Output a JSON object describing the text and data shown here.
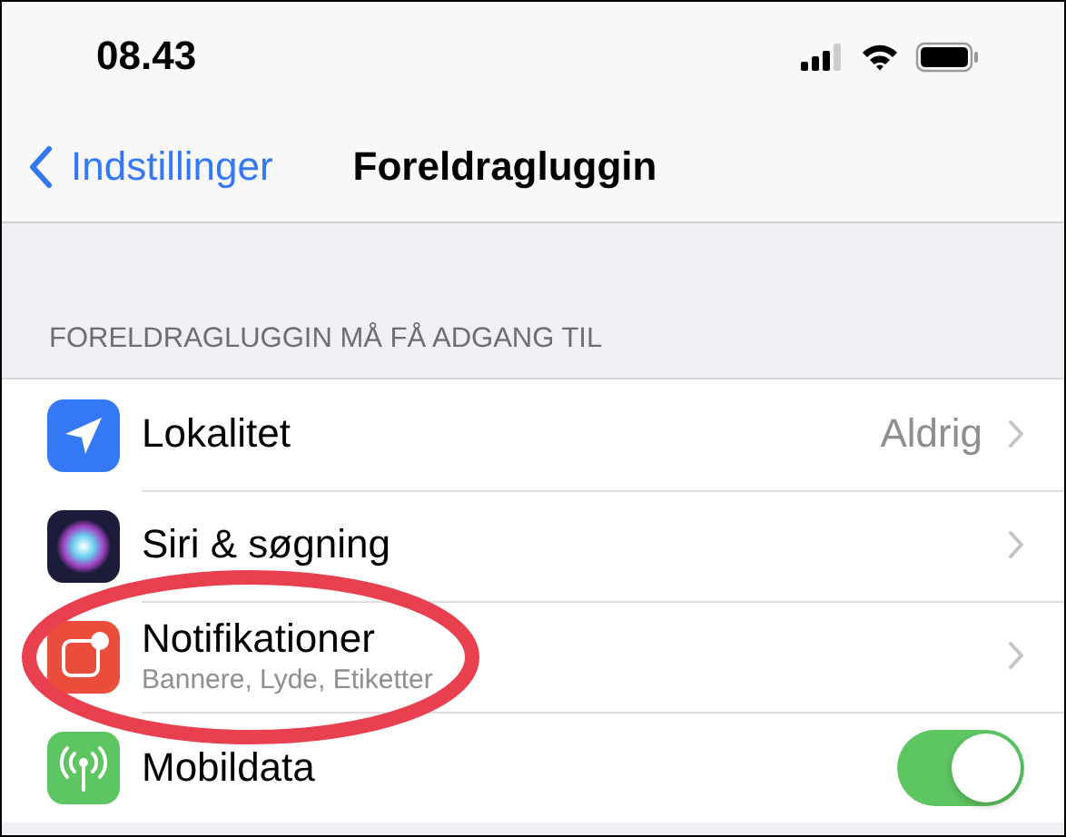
{
  "status_bar": {
    "time": "08.43"
  },
  "nav": {
    "back": "Indstillinger",
    "title": "Foreldragluggin"
  },
  "section": {
    "header": "FORELDRAGLUGGIN MÅ FÅ ADGANG TIL",
    "rows": [
      {
        "kind": "link",
        "label": "Lokalitet",
        "value": "Aldrig",
        "highlighted": false
      },
      {
        "kind": "link",
        "label": "Siri & søgning",
        "highlighted": false
      },
      {
        "kind": "link",
        "label": "Notifikationer",
        "subtitle": "Bannere, Lyde, Etiketter",
        "highlighted": true
      },
      {
        "kind": "toggle",
        "label": "Mobildata",
        "on": true,
        "highlighted": false
      }
    ]
  }
}
